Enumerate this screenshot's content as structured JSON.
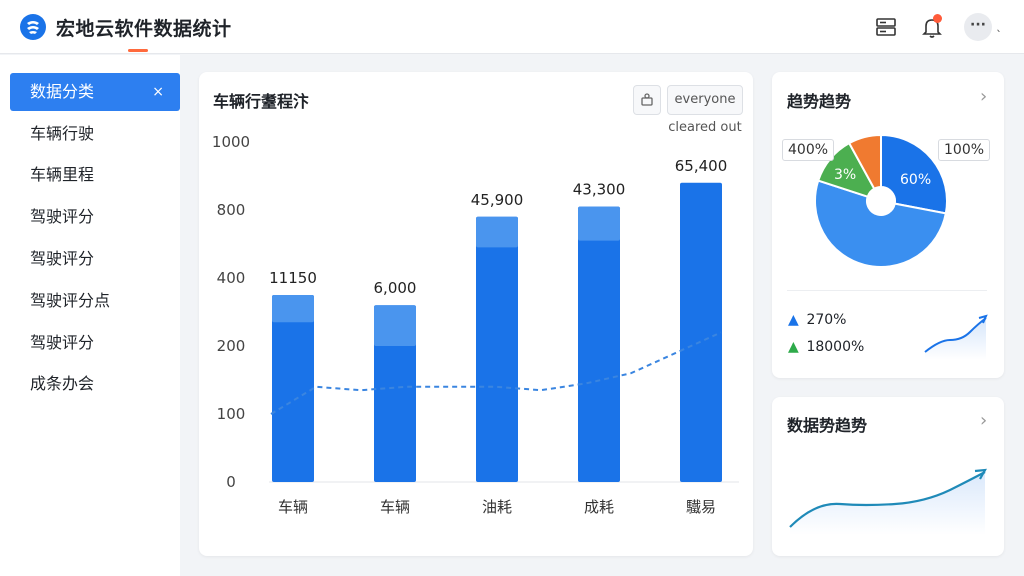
{
  "header": {
    "title": "宏地云软件数据统计",
    "icons": [
      "logo-icon",
      "server-icon",
      "bell-icon",
      "more-icon"
    ],
    "avatar_label": "···",
    "accent_color": "#ff6a3d"
  },
  "sidebar": {
    "items": [
      {
        "label": "数据分类",
        "active": true
      },
      {
        "label": "车辆行驶"
      },
      {
        "label": "车辆里程"
      },
      {
        "label": "驾驶评分"
      },
      {
        "label": "驾驶评分"
      },
      {
        "label": "驾驶评分点"
      },
      {
        "label": "驾驶评分"
      },
      {
        "label": "成条办会"
      }
    ],
    "close_glyph": "×"
  },
  "main_card": {
    "title": "车辆行耋程汴",
    "buttons": {
      "export_icon": "export-icon",
      "action_label": "everyone cleared out"
    },
    "chart_data": {
      "type": "bar",
      "categories": [
        "车辆",
        "车辆",
        "油耗",
        "成耗",
        "驖易"
      ],
      "y_tick_labels": [
        "0",
        "100",
        "200",
        "400",
        "800",
        "1000"
      ],
      "data_labels": [
        "11150",
        "6,000",
        "45,900",
        "43,300",
        "65,400"
      ],
      "bar_levels": [
        0.55,
        0.52,
        0.78,
        0.81,
        0.88
      ],
      "highlight_levels": [
        0.08,
        0.12,
        0.09,
        0.1,
        0.0
      ],
      "trend_line_levels": [
        0.2,
        0.28,
        0.27,
        0.28,
        0.28,
        0.28,
        0.27,
        0.29,
        0.32,
        0.38,
        0.44
      ],
      "colors": {
        "bar": "#1a73e8",
        "bar_top": "#4a95ee",
        "trend": "#3a85e0"
      },
      "grid": false
    }
  },
  "trend_card": {
    "title": "趋势趋势",
    "chart_data": {
      "type": "pie",
      "slices": [
        {
          "label": "60%",
          "value": 28,
          "color": "#1a73e8"
        },
        {
          "label": "",
          "value": 52,
          "color": "#3a8ff0"
        },
        {
          "label": "3%",
          "value": 12,
          "color": "#4caf50"
        },
        {
          "label": "",
          "value": 8,
          "color": "#f07a30"
        }
      ],
      "callouts": [
        "400%",
        "100%"
      ]
    },
    "stats": [
      {
        "arrow": "▲",
        "value": "2⁠70%",
        "color": "#1a73e8"
      },
      {
        "arrow": "▲",
        "value": "18000%",
        "color": "#2eaa4a"
      }
    ]
  },
  "data_trend_card": {
    "title": "数据势趋势"
  }
}
